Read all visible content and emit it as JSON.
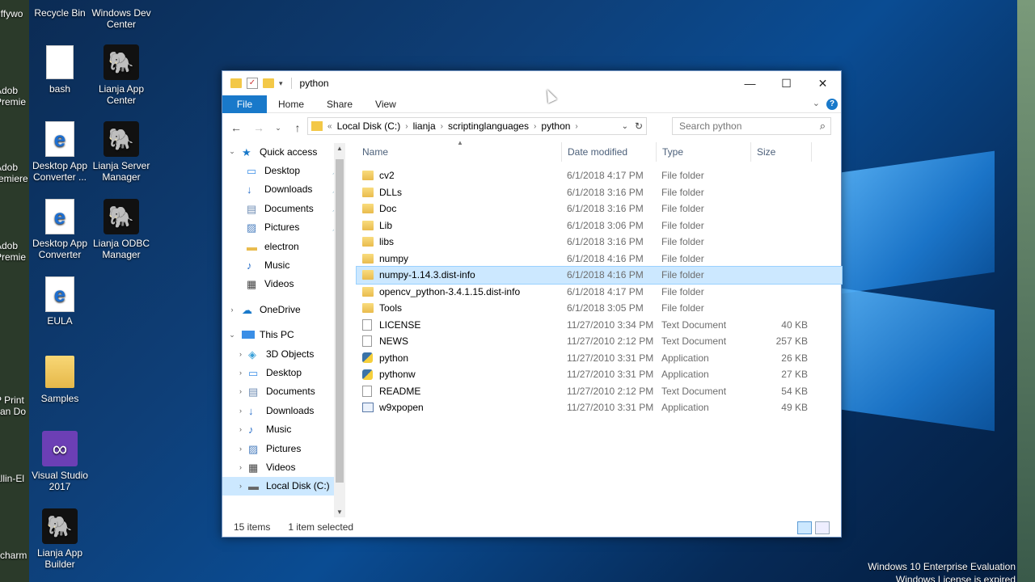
{
  "desktop": {
    "icons": [
      {
        "label": "Recycle Bin"
      },
      {
        "label": "Windows Dev Center"
      },
      {
        "label": "bash"
      },
      {
        "label": "Lianja App Center"
      },
      {
        "label": "Desktop App Converter ..."
      },
      {
        "label": "Lianja Server Manager"
      },
      {
        "label": "Desktop App Converter"
      },
      {
        "label": "Lianja ODBC Manager"
      },
      {
        "label": "EULA"
      },
      {
        "label": "Samples"
      },
      {
        "label": "Visual Studio 2017"
      },
      {
        "label": "Lianja App Builder"
      }
    ],
    "left_cut_labels": [
      "uffywo",
      "Adob Premie",
      "Adob remiere",
      "Adob Premie",
      "P Print can Do",
      "allin-El",
      "ycharm"
    ],
    "watermark_line1": "Windows 10 Enterprise Evaluation",
    "watermark_line2": "Windows License is expired"
  },
  "window": {
    "title": "python",
    "ribbon_tabs": [
      "File",
      "Home",
      "Share",
      "View"
    ],
    "breadcrumb_prefix": "«",
    "breadcrumbs": [
      "Local Disk (C:)",
      "lianja",
      "scriptinglanguages",
      "python"
    ],
    "search_placeholder": "Search python",
    "nav": {
      "quick_access": "Quick access",
      "quick_items": [
        "Desktop",
        "Downloads",
        "Documents",
        "Pictures",
        "electron",
        "Music",
        "Videos"
      ],
      "onedrive": "OneDrive",
      "this_pc": "This PC",
      "pc_items": [
        "3D Objects",
        "Desktop",
        "Documents",
        "Downloads",
        "Music",
        "Pictures",
        "Videos",
        "Local Disk (C:)"
      ]
    },
    "columns": [
      "Name",
      "Date modified",
      "Type",
      "Size"
    ],
    "files": [
      {
        "name": "cv2",
        "date": "6/1/2018 4:17 PM",
        "type": "File folder",
        "size": "",
        "icon": "folder-icon"
      },
      {
        "name": "DLLs",
        "date": "6/1/2018 3:16 PM",
        "type": "File folder",
        "size": "",
        "icon": "folder-icon"
      },
      {
        "name": "Doc",
        "date": "6/1/2018 3:16 PM",
        "type": "File folder",
        "size": "",
        "icon": "folder-icon"
      },
      {
        "name": "Lib",
        "date": "6/1/2018 3:06 PM",
        "type": "File folder",
        "size": "",
        "icon": "folder-icon"
      },
      {
        "name": "libs",
        "date": "6/1/2018 3:16 PM",
        "type": "File folder",
        "size": "",
        "icon": "folder-icon"
      },
      {
        "name": "numpy",
        "date": "6/1/2018 4:16 PM",
        "type": "File folder",
        "size": "",
        "icon": "folder-icon"
      },
      {
        "name": "numpy-1.14.3.dist-info",
        "date": "6/1/2018 4:16 PM",
        "type": "File folder",
        "size": "",
        "icon": "folder-icon",
        "selected": true
      },
      {
        "name": "opencv_python-3.4.1.15.dist-info",
        "date": "6/1/2018 4:17 PM",
        "type": "File folder",
        "size": "",
        "icon": "folder-icon"
      },
      {
        "name": "Tools",
        "date": "6/1/2018 3:05 PM",
        "type": "File folder",
        "size": "",
        "icon": "folder-icon"
      },
      {
        "name": "LICENSE",
        "date": "11/27/2010 3:34 PM",
        "type": "Text Document",
        "size": "40 KB",
        "icon": "document-icon"
      },
      {
        "name": "NEWS",
        "date": "11/27/2010 2:12 PM",
        "type": "Text Document",
        "size": "257 KB",
        "icon": "document-icon"
      },
      {
        "name": "python",
        "date": "11/27/2010 3:31 PM",
        "type": "Application",
        "size": "26 KB",
        "icon": "python-icon"
      },
      {
        "name": "pythonw",
        "date": "11/27/2010 3:31 PM",
        "type": "Application",
        "size": "27 KB",
        "icon": "python-icon"
      },
      {
        "name": "README",
        "date": "11/27/2010 2:12 PM",
        "type": "Text Document",
        "size": "54 KB",
        "icon": "document-icon"
      },
      {
        "name": "w9xpopen",
        "date": "11/27/2010 3:31 PM",
        "type": "Application",
        "size": "49 KB",
        "icon": "application-icon"
      }
    ],
    "status_items": "15 items",
    "status_selected": "1 item selected"
  },
  "colors": {
    "accent": "#1979ca",
    "selection": "#cce8ff"
  }
}
